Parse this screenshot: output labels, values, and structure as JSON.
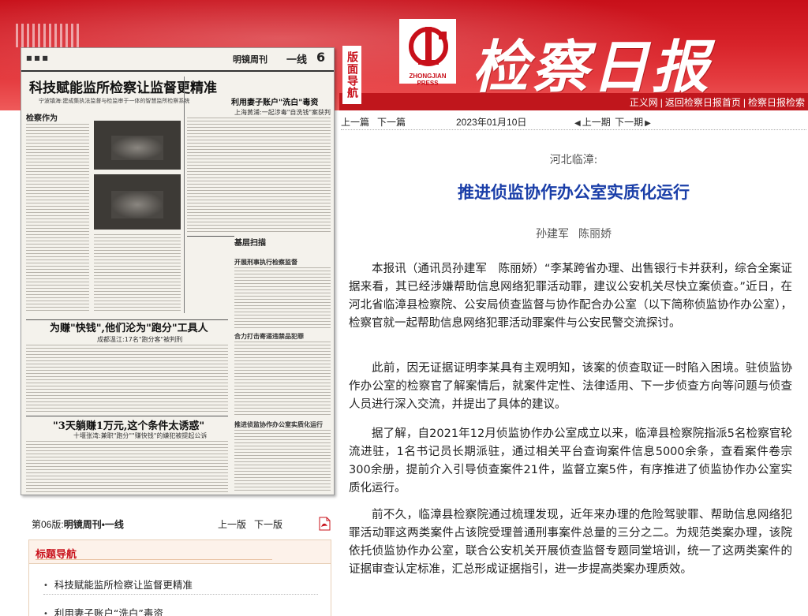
{
  "masthead": {
    "title": "检察日报",
    "press": "ZHONGJIAN PRESS",
    "guide": "版面导航",
    "links": [
      "正义网",
      "返回检察日报首页",
      "检察日报检索"
    ]
  },
  "paper_thumb": {
    "column": "明镜周刊",
    "section": "一线",
    "page_num": "6",
    "headline": "科技赋能监所检察让监督更精准",
    "subhead": "宁波镇海:建成集执法监督与检监审于一体的智慧监所检察系统",
    "right_head": "利用妻子账户\"洗白\"毒资",
    "right_sub": "上海黄浦:一起涉毒\"自洗钱\"案获判",
    "side_section1": "检察作为",
    "side_section2": "基层扫描",
    "item_a": "开展刑事执行检察监督",
    "item_b": "合力打击寄递违禁品犯罪",
    "item_c": "推进侦监协作办公室实质化运行",
    "mid_head": "为赚\"快钱\",他们沦为\"跑分\"工具人",
    "mid_sub": "成都温江:17名\"跑分客\"被判刑",
    "bot_head": "\"3天躺赚1万元,这个条件太诱惑\"",
    "bot_sub": "十堰张湾:兼职\"跑分\"\"赚快钱\"的嫌犯被提起公诉"
  },
  "article_nav": {
    "prev": "上一篇",
    "next": "下一篇",
    "date": "2023年01月10日",
    "prev_issue": "上一期",
    "next_issue": "下一期"
  },
  "article": {
    "kicker": "河北临漳:",
    "title": "推进侦监协作办公室实质化运行",
    "authors": [
      "孙建军",
      "陈丽娇"
    ],
    "paragraphs": [
      "本报讯（通讯员孙建军　陈丽娇）“李某跨省办理、出售银行卡并获利，综合全案证据来看，其已经涉嫌帮助信息网络犯罪活动罪，建议公安机关尽快立案侦查。”近日，在河北省临漳县检察院、公安局侦查监督与协作配合办公室（以下简称侦监协作办公室），检察官就一起帮助信息网络犯罪活动罪案件与公安民警交流探讨。",
      "此前，因无证据证明李某具有主观明知，该案的侦查取证一时陷入困境。驻侦监协作办公室的检察官了解案情后，就案件定性、法律适用、下一步侦查方向等问题与侦查人员进行深入交流，并提出了具体的建议。",
      "据了解，自2021年12月侦监协作办公室成立以来，临漳县检察院指派5名检察官轮流进驻，1名书记员长期派驻，通过相关平台查询案件信息5000余条，查看案件卷宗300余册，提前介入引导侦查案件21件，监督立案5件，有序推进了侦监协作办公室实质化运行。",
      "前不久，临漳县检察院通过梳理发现，近年来办理的危险驾驶罪、帮助信息网络犯罪活动罪这两类案件占该院受理普通刑事案件总量的三分之二。为规范类案办理，该院依托侦监协作办公室，联合公安机关开展侦查监督专题同堂培训，统一了这两类案件的证据审查认定标准，汇总形成证据指引，进一步提高类案办理质效。"
    ]
  },
  "page_info": {
    "label": "第06版:",
    "name": "明镜周刊•一线",
    "prev": "上一版",
    "next": "下一版"
  },
  "toc": {
    "header": "标题导航",
    "items": [
      "科技赋能监所检察让监督更精准",
      "利用妻子账户“洗白”毒资"
    ]
  }
}
